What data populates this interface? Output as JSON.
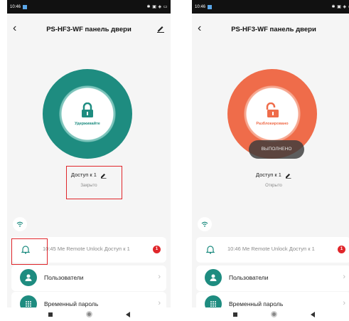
{
  "colors": {
    "locked_ring": "#1e8c80",
    "unlocked_ring": "#ef6c4a",
    "highlight_box": "#e0262b",
    "badge": "#e0262b"
  },
  "left": {
    "status": {
      "time": "10:46",
      "icons": "✱ ▣ ◈ ▭"
    },
    "header": {
      "back_icon": "‹",
      "title": "PS-HF3-WF панель двери"
    },
    "lock": {
      "state_label": "Удерживайте",
      "icon": "locked-padlock-icon"
    },
    "access": {
      "label": "Доступ к 1",
      "state": "Закрыто"
    },
    "log": {
      "text": "10:45 Me  Remote Unlock Доступ к 1",
      "badge": "1"
    },
    "menu": [
      {
        "label": "Пользователи",
        "icon": "user-icon"
      },
      {
        "label": "Временный пароль",
        "icon": "keypad-icon"
      }
    ]
  },
  "right": {
    "status": {
      "time": "10:46",
      "icons": "✱ ▣ ◈ ▭"
    },
    "header": {
      "back_icon": "‹",
      "title": "PS-HF3-WF панель двери"
    },
    "lock": {
      "state_label": "Разблокировано",
      "icon": "unlocked-padlock-icon",
      "toast": "ВЫПОЛНЕНО"
    },
    "access": {
      "label": "Доступ к 1",
      "state": "Открыто"
    },
    "log": {
      "text": "10:46 Me  Remote Unlock Доступ к 1",
      "badge": "1"
    },
    "menu": [
      {
        "label": "Пользователи",
        "icon": "user-icon"
      },
      {
        "label": "Временный пароль",
        "icon": "keypad-icon"
      }
    ]
  }
}
